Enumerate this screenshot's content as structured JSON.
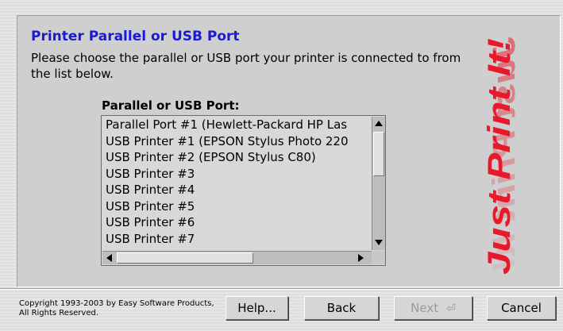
{
  "heading": "Printer Parallel or USB Port",
  "description": "Please choose the parallel or USB port your printer is connected to from the list below.",
  "list": {
    "label": "Parallel or USB Port:",
    "items": [
      "Parallel Port #1 (Hewlett-Packard HP Las",
      "USB Printer #1 (EPSON Stylus Photo 220",
      "USB Printer #2 (EPSON Stylus C80)",
      "USB Printer #3",
      "USB Printer #4",
      "USB Printer #5",
      "USB Printer #6",
      "USB Printer #7"
    ]
  },
  "logo_text": "Just Print It!",
  "logo_color": "#e8192a",
  "accent_color": "#1a1ad2",
  "copyright": "Copyright 1993-2003 by Easy Software Products, All Rights Reserved.",
  "buttons": {
    "help": "Help...",
    "back": "Back",
    "next": "Next",
    "next_icon": "enter-arrow-icon",
    "cancel": "Cancel"
  }
}
